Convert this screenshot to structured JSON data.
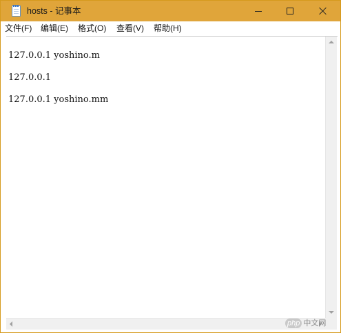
{
  "window": {
    "title": "hosts - 记事本",
    "colors": {
      "titlebar": "#e0a53a",
      "border": "#d69a1c"
    }
  },
  "icons": {
    "app": "notepad-icon",
    "minimize": "minimize-icon",
    "maximize": "maximize-icon",
    "close": "close-icon"
  },
  "menubar": {
    "items": [
      {
        "label": "文件(F)"
      },
      {
        "label": "编辑(E)"
      },
      {
        "label": "格式(O)"
      },
      {
        "label": "查看(V)"
      },
      {
        "label": "帮助(H)"
      }
    ]
  },
  "editor": {
    "lines": [
      "127.0.0.1 yoshino.m",
      "127.0.0.1",
      "127.0.0.1 yoshino.mm"
    ]
  },
  "watermark": {
    "logo": "php",
    "text": "中文网"
  }
}
